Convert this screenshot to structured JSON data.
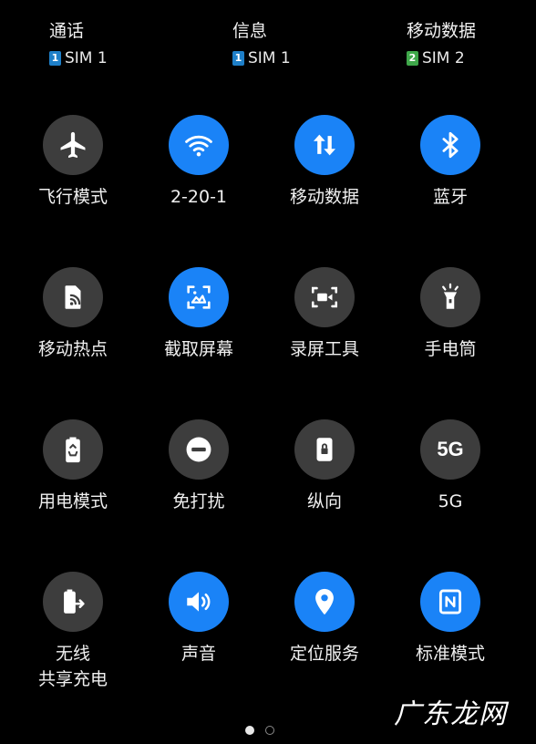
{
  "sim_selector": [
    {
      "title": "通话",
      "card_num": "1",
      "card_label": "SIM 1",
      "chip_color": "#1e7fc8"
    },
    {
      "title": "信息",
      "card_num": "1",
      "card_label": "SIM 1",
      "chip_color": "#1e7fc8"
    },
    {
      "title": "移动数据",
      "card_num": "2",
      "card_label": "SIM 2",
      "chip_color": "#3fa84a"
    }
  ],
  "colors": {
    "active": "#1a83f7",
    "inactive": "#3d3d3d",
    "background": "#000000"
  },
  "tiles": [
    {
      "label": "飞行模式",
      "icon": "airplane-icon",
      "state": "off"
    },
    {
      "label": "2-20-1",
      "icon": "wifi-icon",
      "state": "on"
    },
    {
      "label": "移动数据",
      "icon": "mobile-data-icon",
      "state": "on"
    },
    {
      "label": "蓝牙",
      "icon": "bluetooth-icon",
      "state": "on"
    },
    {
      "label": "移动热点",
      "icon": "hotspot-icon",
      "state": "off"
    },
    {
      "label": "截取屏幕",
      "icon": "screenshot-icon",
      "state": "on"
    },
    {
      "label": "录屏工具",
      "icon": "screen-record-icon",
      "state": "off"
    },
    {
      "label": "手电筒",
      "icon": "flashlight-icon",
      "state": "off"
    },
    {
      "label": "用电模式",
      "icon": "battery-saver-icon",
      "state": "off"
    },
    {
      "label": "免打扰",
      "icon": "do-not-disturb-icon",
      "state": "off"
    },
    {
      "label": "纵向",
      "icon": "portrait-lock-icon",
      "state": "off"
    },
    {
      "label": "5G",
      "icon": "5g-icon",
      "icon_text": "5G",
      "state": "off"
    },
    {
      "label": "无线",
      "label_line2": "共享充电",
      "icon": "wireless-charging-icon",
      "state": "off"
    },
    {
      "label": "声音",
      "icon": "sound-icon",
      "state": "on"
    },
    {
      "label": "定位服务",
      "icon": "location-icon",
      "state": "on"
    },
    {
      "label": "标准模式",
      "icon": "nfc-icon",
      "state": "on"
    }
  ],
  "pager": {
    "total": 2,
    "active_index": 0
  },
  "watermark": "广东龙网"
}
